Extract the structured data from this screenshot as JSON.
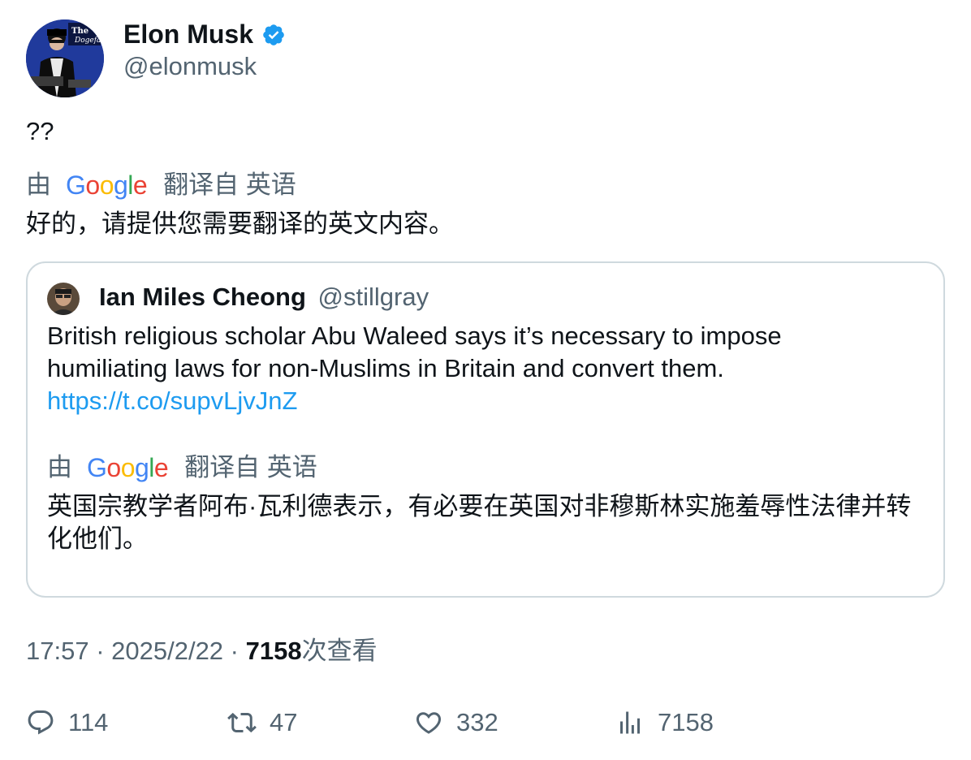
{
  "tweet": {
    "author": {
      "name": "Elon Musk",
      "handle": "@elonmusk",
      "verified": true
    },
    "text": "??",
    "translation": {
      "by": "由",
      "provider": "Google",
      "from": "翻译自 英语",
      "text": "好的，请提供您需要翻译的英文内容。"
    },
    "quote": {
      "author": {
        "name": "Ian Miles Cheong",
        "handle": "@stillgray"
      },
      "text": "British religious scholar Abu Waleed says it’s necessary to impose humiliating laws for non-Muslims in Britain and convert them.",
      "link": "https://t.co/supvLjvJnZ",
      "translation": {
        "by": "由",
        "provider": "Google",
        "from": "翻译自 英语",
        "text": "英国宗教学者阿布·瓦利德表示，有必要在英国对非穆斯林实施羞辱性法律并转化他们。"
      }
    },
    "meta": {
      "time": "17:57",
      "sep1": " · ",
      "date": "2025/2/22",
      "sep2": " · ",
      "views": "7158",
      "views_label": "次查看"
    },
    "actions": {
      "replies": "114",
      "retweets": "47",
      "likes": "332",
      "views": "7158"
    }
  },
  "colors": {
    "text": "#0f1419",
    "secondary": "#536471",
    "link": "#1d9bf0",
    "border": "#cfd9de",
    "verified": "#1d9bf0"
  },
  "icons": [
    "verified-badge-icon",
    "reply-icon",
    "retweet-icon",
    "like-icon",
    "views-icon"
  ]
}
